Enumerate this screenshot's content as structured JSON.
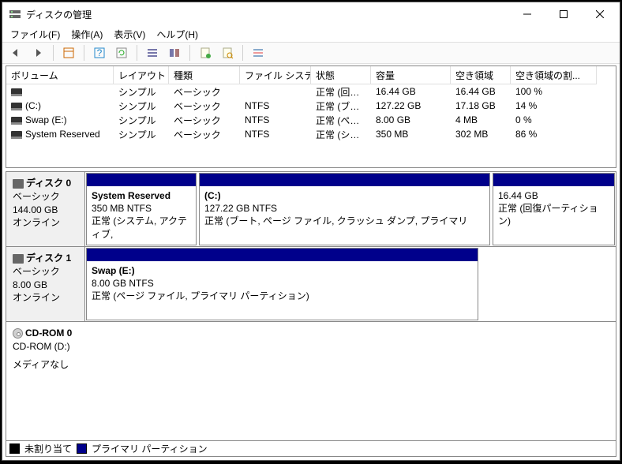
{
  "window": {
    "title": "ディスクの管理"
  },
  "menu": {
    "file": "ファイル(F)",
    "action": "操作(A)",
    "view": "表示(V)",
    "help": "ヘルプ(H)"
  },
  "cols": {
    "volume": "ボリューム",
    "layout": "レイアウト",
    "type": "種類",
    "fs": "ファイル システム",
    "status": "状態",
    "capacity": "容量",
    "free": "空き領域",
    "freepct": "空き領域の割..."
  },
  "rows": [
    {
      "vol": "",
      "layout": "シンプル",
      "type": "ベーシック",
      "fs": "",
      "status": "正常 (回復...",
      "cap": "16.44 GB",
      "free": "16.44 GB",
      "pct": "100 %"
    },
    {
      "vol": "(C:)",
      "layout": "シンプル",
      "type": "ベーシック",
      "fs": "NTFS",
      "status": "正常 (ブート...",
      "cap": "127.22 GB",
      "free": "17.18 GB",
      "pct": "14 %"
    },
    {
      "vol": "Swap (E:)",
      "layout": "シンプル",
      "type": "ベーシック",
      "fs": "NTFS",
      "status": "正常 (ペー...",
      "cap": "8.00 GB",
      "free": "4 MB",
      "pct": "0 %"
    },
    {
      "vol": "System Reserved",
      "layout": "シンプル",
      "type": "ベーシック",
      "fs": "NTFS",
      "status": "正常 (シス...",
      "cap": "350 MB",
      "free": "302 MB",
      "pct": "86 %"
    }
  ],
  "disk0": {
    "name": "ディスク 0",
    "type": "ベーシック",
    "size": "144.00 GB",
    "state": "オンライン",
    "p1": {
      "name": "System Reserved",
      "size": "350 MB NTFS",
      "stat": "正常 (システム, アクティブ,"
    },
    "p2": {
      "name": "(C:)",
      "size": "127.22 GB NTFS",
      "stat": "正常 (ブート, ページ ファイル, クラッシュ ダンプ, プライマリ"
    },
    "p3": {
      "name": "",
      "size": "16.44 GB",
      "stat": "正常 (回復パーティション)"
    }
  },
  "disk1": {
    "name": "ディスク 1",
    "type": "ベーシック",
    "size": "8.00 GB",
    "state": "オンライン",
    "p1": {
      "name": "Swap  (E:)",
      "size": "8.00 GB NTFS",
      "stat": "正常 (ページ ファイル, プライマリ パーティション)"
    }
  },
  "cd": {
    "name": "CD-ROM 0",
    "drive": "CD-ROM (D:)",
    "state": "メディアなし"
  },
  "legend": {
    "unalloc": "未割り当て",
    "primary": "プライマリ パーティション"
  }
}
